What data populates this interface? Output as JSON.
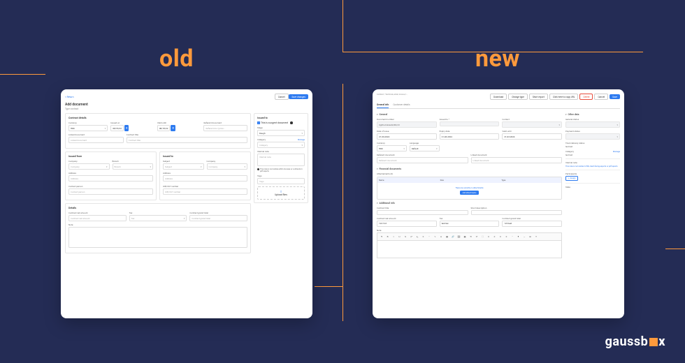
{
  "headings": {
    "old": "old",
    "new": "new"
  },
  "brand": {
    "name": "gaussb",
    "suffix": "x"
  },
  "old": {
    "back": "< Return",
    "title": "Add document",
    "subtitle": "Type contract",
    "cancel": "Cancel",
    "save": "Save changes",
    "details_section": "Contract details",
    "currency": {
      "label": "Currency",
      "value": "HRK"
    },
    "issued_on": {
      "label": "Issued on",
      "value": "08/18/22"
    },
    "valid_until": {
      "label": "Valid until",
      "value": "08/18/22"
    },
    "referent": {
      "label": "Referent document",
      "placeholder": "Referent doc (price..."
    },
    "linked": {
      "label": "Linked document",
      "placeholder": "Linked document"
    },
    "contract_title": {
      "label": "Contract title",
      "placeholder": "Contract title"
    },
    "issued_from": "Issued from",
    "issued_to": "Issued to",
    "company": {
      "label": "Company",
      "placeholder": "Company"
    },
    "branch": {
      "label": "Branch",
      "placeholder": "Branch"
    },
    "address": {
      "label": "Address",
      "placeholder": "Address"
    },
    "contact_person": {
      "label": "Contact person",
      "placeholder": "Contact person"
    },
    "subject": {
      "label": "Subject",
      "placeholder": "Subject"
    },
    "oib": {
      "label": "OIB/VAT number",
      "placeholder": "OIB/VAT number"
    },
    "details2": "Details",
    "net": {
      "label": "Contract net amount",
      "placeholder": "Contract net amount"
    },
    "tax": {
      "label": "Tax",
      "placeholder": "Tax"
    },
    "grand": {
      "label": "Contract grand total",
      "placeholder": "Contract grand total"
    },
    "note": {
      "label": "Note"
    },
    "sidebar": {
      "issued_to": "Issued to",
      "urgent": "This is a urgent document",
      "stage": {
        "label": "Stage",
        "value": "Rough"
      },
      "category": {
        "label": "Category",
        "placeholder": "Category",
        "manage": "Manage"
      },
      "internal": {
        "label": "Internal note",
        "placeholder": "Internal note"
      },
      "note_hint": "This note is not visible within invoices or contracts in pdf reports",
      "tags": {
        "label": "Tags",
        "placeholder": "Tags"
      },
      "upload": "Upload files"
    }
  },
  "new": {
    "breadcrumb": "Contract / Technical, email, invoice, t...",
    "buttons": {
      "download": "Download",
      "change_type": "Change type",
      "short_report": "Short report",
      "copy": "Click here to copy URL",
      "delete": "Delete",
      "cancel": "Cancel",
      "save": "Save"
    },
    "tabs": {
      "general": "General info",
      "customer": "Customer details"
    },
    "sections": {
      "general": "General",
      "financial": "Financial documents",
      "additional": "Additional info",
      "other": "Other data"
    },
    "doc_number": {
      "label": "Document number",
      "value": "UgPruzUsluGAUSS/23"
    },
    "issued_to": {
      "label": "Issued to *"
    },
    "contact": {
      "label": "Contact"
    },
    "date_issue": {
      "label": "Date of issue",
      "value": "21-03-2024"
    },
    "expiry": {
      "label": "Expiry date",
      "value": "21-03-2024"
    },
    "valid_until": {
      "label": "Valid until",
      "value": "21-03-2024"
    },
    "currency": {
      "label": "Currency",
      "value": "HRK"
    },
    "language": {
      "label": "Language",
      "value": "Default"
    },
    "referent": {
      "label": "Referent document",
      "placeholder": "Referent document"
    },
    "linked": {
      "label": "Linked document",
      "placeholder": "Linked document"
    },
    "attachments": {
      "title": "Attachements (0)",
      "col1": "Name",
      "col2": "Size",
      "col3": "Type",
      "empty": "There are currently no attachments",
      "add": "Add attachments"
    },
    "contract_title": {
      "label": "Contract title"
    },
    "short_desc": {
      "label": "Short description"
    },
    "net": {
      "label": "Contract net amount",
      "value": "123.123"
    },
    "tax": {
      "label": "Tax",
      "value": "test tax"
    },
    "grand": {
      "label": "Contract grand total",
      "value": "123 test"
    },
    "note": {
      "label": "Note"
    },
    "sidebar": {
      "general_status": {
        "label": "General status"
      },
      "payment_status": {
        "label": "Payment status"
      },
      "track_delivery": {
        "label": "Track delivery status",
        "value": "test test"
      },
      "category": {
        "label": "Category",
        "value": "test test",
        "manage": "Manage"
      },
      "internal": {
        "label": "Internal note",
        "hint": "This note is not visible in PDF, client-facing exports or pdf reports"
      },
      "participants": {
        "label": "Participants",
        "assign": "Assign"
      },
      "state": {
        "label": "State"
      }
    }
  }
}
